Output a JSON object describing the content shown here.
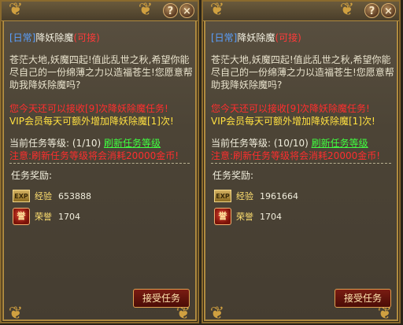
{
  "panels": [
    {
      "tag_daily": "[日常]",
      "quest_name": "降妖除魔",
      "status": "(可接)",
      "description": "苍茫大地,妖魔四起!值此乱世之秋,希望你能尽自己的一份绵薄之力以造福苍生!您愿意帮助我降妖除魔吗?",
      "warning_text": "您今天还可以接收[9]次降妖除魔任务!",
      "vip_text": "VIP会员每天可额外增加降妖除魔[1]次!",
      "level_label": "当前任务等级:",
      "level_value": "(1/10)",
      "refresh_link": "刷新任务等级",
      "cost_note": "注意:刷新任务等级将会消耗20000金币!",
      "reward_title": "任务奖励:",
      "exp_label": "经验",
      "exp_value": "653888",
      "honor_label": "荣誉",
      "honor_value": "1704",
      "accept_button": "接受任务"
    },
    {
      "tag_daily": "[日常]",
      "quest_name": "降妖除魔",
      "status": "(可接)",
      "description": "苍茫大地,妖魔四起!值此乱世之秋,希望你能尽自己的一份绵薄之力以造福苍生!您愿意帮助我降妖除魔吗?",
      "warning_text": "您今天还可以接收[9]次降妖除魔任务!",
      "vip_text": "VIP会员每天可额外增加降妖除魔[1]次!",
      "level_label": "当前任务等级:",
      "level_value": "(10/10)",
      "refresh_link": "刷新任务等级",
      "cost_note": "注意:刷新任务等级将会消耗20000金币!",
      "reward_title": "任务奖励:",
      "exp_label": "经验",
      "exp_value": "1961664",
      "honor_label": "荣誉",
      "honor_value": "1704",
      "accept_button": "接受任务"
    }
  ],
  "icons": {
    "help": "?",
    "close": "×",
    "exp_badge": "EXP",
    "honor_badge": "誉",
    "corner": "❦"
  }
}
